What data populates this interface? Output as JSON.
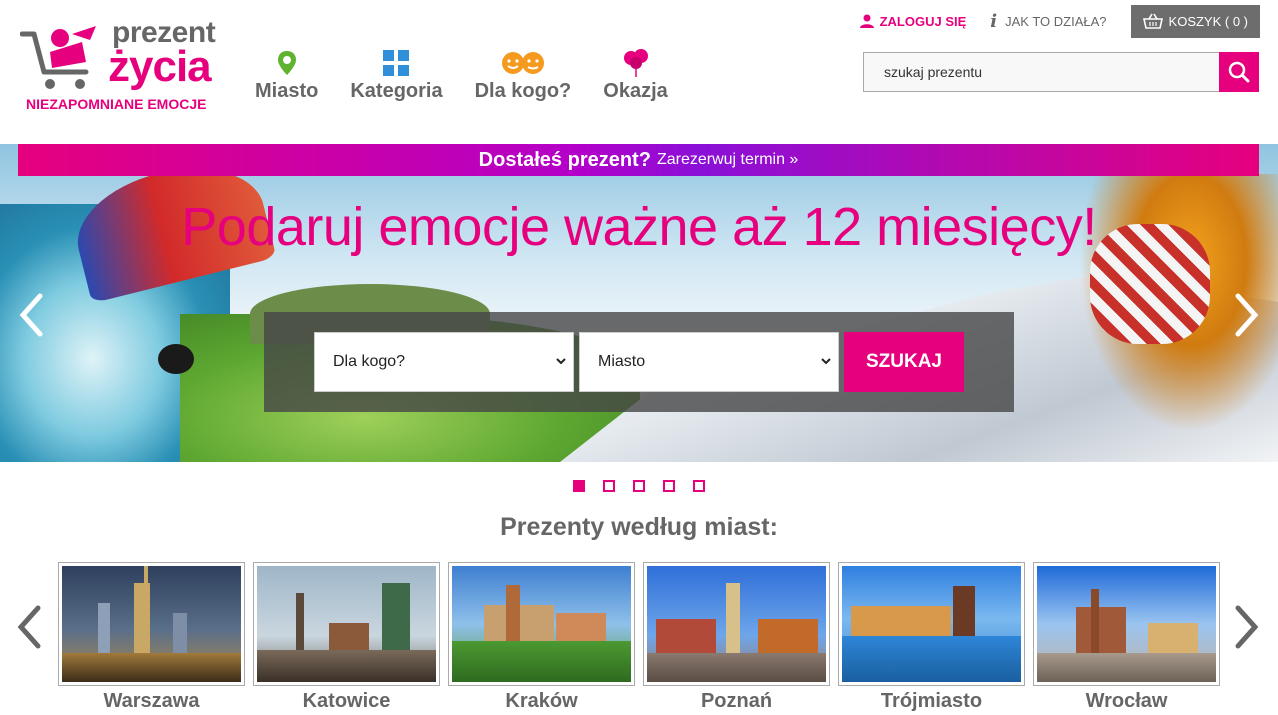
{
  "logo": {
    "line1": "prezent",
    "line2": "życia",
    "tagline": "NIEZAPOMNIANE EMOCJE"
  },
  "nav": [
    {
      "label": "Miasto",
      "icon": "map-pin-icon"
    },
    {
      "label": "Kategoria",
      "icon": "gift-box-icon"
    },
    {
      "label": "Dla kogo?",
      "icon": "faces-icon"
    },
    {
      "label": "Okazja",
      "icon": "balloons-icon"
    }
  ],
  "topbar": {
    "login": "ZALOGUJ SIĘ",
    "how": "JAK TO DZIAŁA?",
    "cart": "KOSZYK ( 0 )"
  },
  "search": {
    "placeholder": "szukaj prezentu",
    "value": "szukaj prezentu"
  },
  "promo": {
    "strong": "Dostałeś prezent?",
    "link": "Zarezerwuj termin »"
  },
  "hero": {
    "headline": "Podaruj emocje ważne aż 12 miesięcy!",
    "select_who": "Dla kogo?",
    "select_city": "Miasto",
    "submit": "SZUKAJ"
  },
  "slider": {
    "count": 5,
    "active": 0
  },
  "cities_section": {
    "title": "Prezenty według miast:",
    "items": [
      "Warszawa",
      "Katowice",
      "Kraków",
      "Poznań",
      "Trójmiasto",
      "Wrocław"
    ]
  },
  "colors": {
    "brand": "#e6007e",
    "text": "#666666",
    "cart_bg": "#6d6d6d"
  }
}
